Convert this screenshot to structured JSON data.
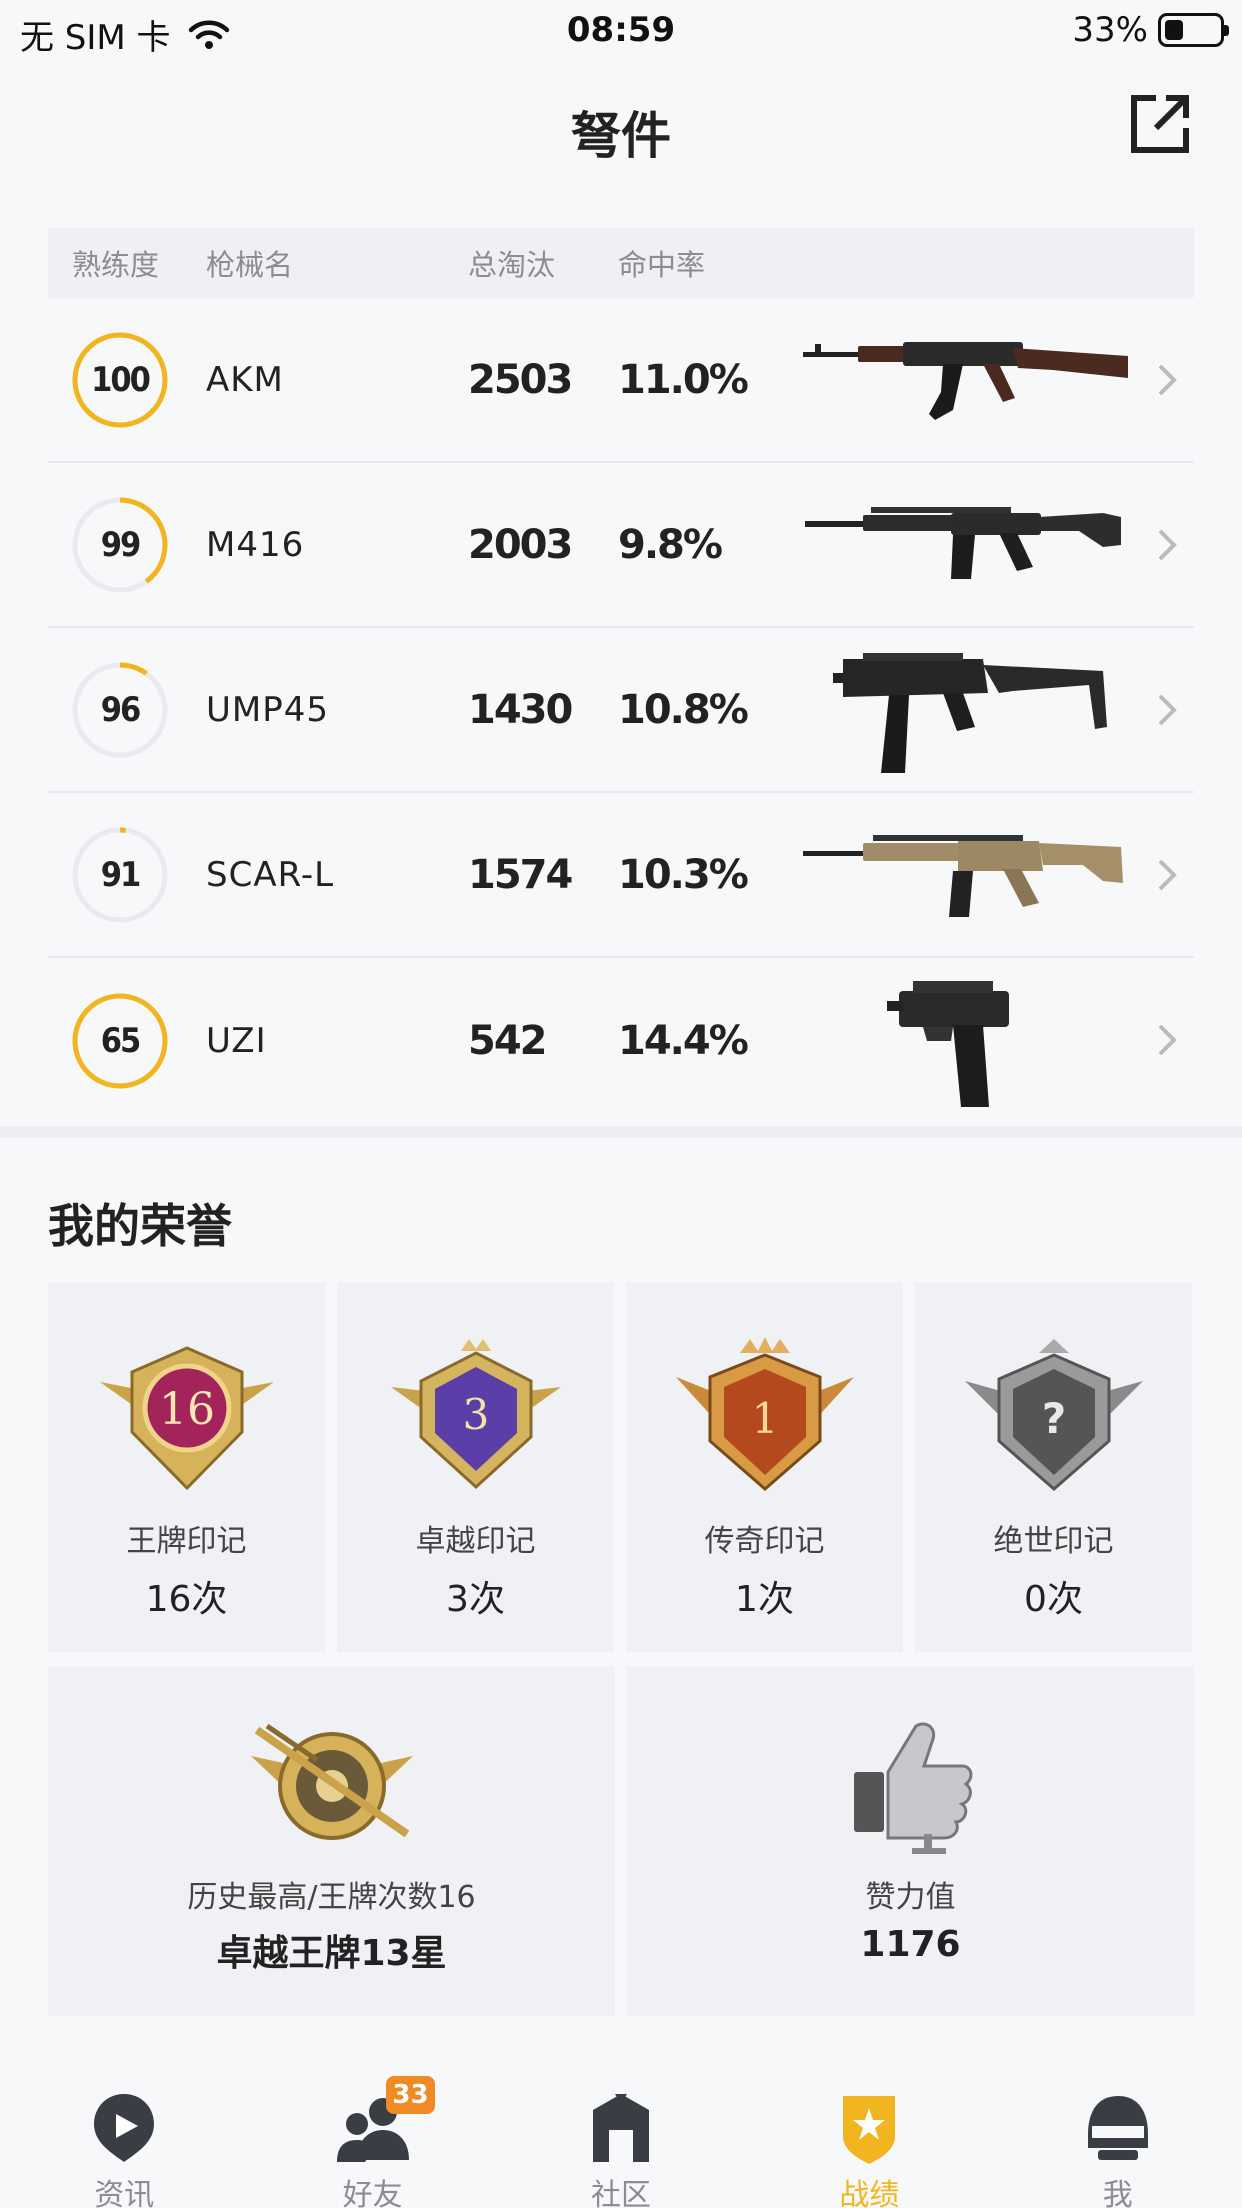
{
  "status_bar": {
    "carrier": "无 SIM 卡",
    "time": "08:59",
    "battery": "33%"
  },
  "header": {
    "title": "弩件"
  },
  "weapon_table": {
    "headers": {
      "proficiency": "熟练度",
      "name": "枪械名",
      "kills": "总淘汰",
      "accuracy": "命中率"
    },
    "rows": [
      {
        "proficiency": "100",
        "name": "AKM",
        "kills": "2503",
        "accuracy": "11.0%"
      },
      {
        "proficiency": "99",
        "name": "M416",
        "kills": "2003",
        "accuracy": "9.8%"
      },
      {
        "proficiency": "96",
        "name": "UMP45",
        "kills": "1430",
        "accuracy": "10.8%"
      },
      {
        "proficiency": "91",
        "name": "SCAR-L",
        "kills": "1574",
        "accuracy": "10.3%"
      },
      {
        "proficiency": "65",
        "name": "UZI",
        "kills": "542",
        "accuracy": "14.4%"
      }
    ],
    "ring_fraction": [
      1.0,
      0.4,
      0.1,
      0.02,
      1.0
    ]
  },
  "honors": {
    "title": "我的荣誉",
    "marks": [
      {
        "label": "王牌印记",
        "value": "16次",
        "badge_text": "16"
      },
      {
        "label": "卓越印记",
        "value": "3次",
        "badge_text": "3"
      },
      {
        "label": "传奇印记",
        "value": "1次",
        "badge_text": "1"
      },
      {
        "label": "绝世印记",
        "value": "0次",
        "badge_text": "?"
      }
    ],
    "history": {
      "label": "历史最高/王牌次数16",
      "value": "卓越王牌13星"
    },
    "likes": {
      "label": "赞力值",
      "value": "1176"
    }
  },
  "tabbar": {
    "tabs": [
      {
        "label": "资讯",
        "icon": "news-icon"
      },
      {
        "label": "好友",
        "icon": "friends-icon",
        "badge": "33"
      },
      {
        "label": "社区",
        "icon": "community-icon"
      },
      {
        "label": "战绩",
        "icon": "record-icon"
      },
      {
        "label": "我",
        "icon": "helmet-icon"
      }
    ],
    "active": "战绩"
  },
  "colors": {
    "accent": "#f0b51f",
    "badge": "#f08a24",
    "ring_track": "#e9eaed"
  }
}
